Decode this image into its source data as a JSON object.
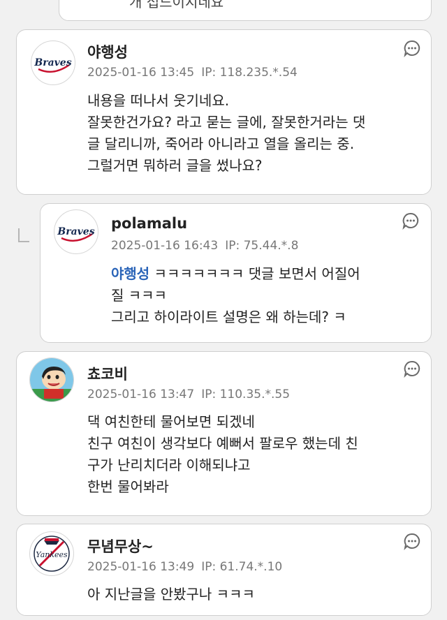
{
  "top_partial": {
    "text": "개 접드이지네요"
  },
  "comments": [
    {
      "author": "야행성",
      "date": "2025-01-16 13:45",
      "ip": "IP: 118.235.*.54",
      "avatar_icon": "braves-logo-icon",
      "lines": [
        "내용을 떠나서 웃기네요.",
        "잘못한건가요? 라고 묻는 글에, 잘못한거라는 댓",
        "글 달리니까, 죽어라 아니라고 열을 올리는 중.",
        "그럴거면 뭐하러 글을 썼나요?"
      ]
    },
    {
      "author": "polamalu",
      "date": "2025-01-16 16:43",
      "ip": "IP: 75.44.*.8",
      "avatar_icon": "braves-logo-icon",
      "mention": "야행성",
      "first_line_rest": " ㅋㅋㅋㅋㅋㅋㅋ 댓글 보면서 어질어",
      "lines": [
        "질 ㅋㅋㅋ",
        "그리고 하이라이트 설명은 왜 하는데? ㅋ"
      ]
    },
    {
      "author": "쵸코비",
      "date": "2025-01-16 13:47",
      "ip": "IP: 110.35.*.55",
      "avatar_icon": "cartoon-boy-avatar-icon",
      "lines": [
        "댁 여친한테 물어보면 되겠네",
        "친구 여친이 생각보다 예뻐서 팔로우 했는데 친",
        "구가 난리치더라 이해되냐고",
        "한번 물어봐라"
      ]
    },
    {
      "author": "무념무상~",
      "date": "2025-01-16 13:49",
      "ip": "IP: 61.74.*.10",
      "avatar_icon": "yankees-logo-icon",
      "lines": [
        "아 지난글을 안봤구나 ㅋㅋㅋ"
      ]
    }
  ],
  "colors": {
    "background": "#f1f1f1",
    "card": "#ffffff",
    "mention": "#2a64b8",
    "braves_red": "#c8102e",
    "braves_navy": "#13274f"
  }
}
